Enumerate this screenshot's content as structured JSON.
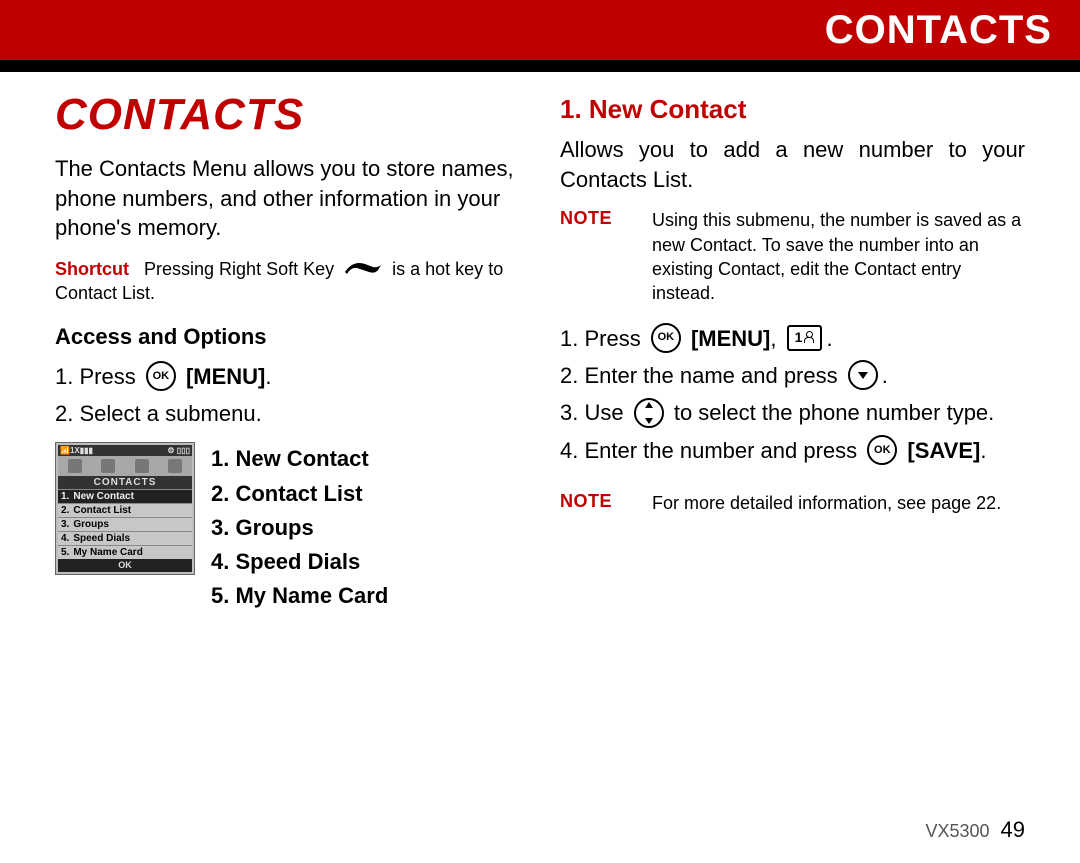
{
  "header": {
    "title": "CONTACTS"
  },
  "left": {
    "chapter": "CONTACTS",
    "intro": "The Contacts Menu allows you to store names, phone numbers, and other information in your phone's memory.",
    "shortcut_label": "Shortcut",
    "shortcut_pre": "Pressing Right Soft Key",
    "shortcut_post": "is a hot key to Contact List.",
    "access_heading": "Access and Options",
    "step1_pre": "1. Press",
    "step1_post": "[MENU]",
    "step2": "2. Select a submenu.",
    "phone": {
      "title": "CONTACTS",
      "items": [
        "New Contact",
        "Contact List",
        "Groups",
        "Speed Dials",
        "My Name Card"
      ],
      "ok": "OK"
    },
    "menu": {
      "i1": "1. New Contact",
      "i2": "2. Contact List",
      "i3": "3. Groups",
      "i4": "4. Speed Dials",
      "i5": "5. My Name Card"
    }
  },
  "right": {
    "heading": "1. New Contact",
    "intro": "Allows you to add a new number to your Contacts List.",
    "note1_label": "NOTE",
    "note1": "Using this submenu, the number is saved as a new Contact. To save the number into an existing Contact, edit the Contact entry instead.",
    "s1_pre": "1. Press",
    "s1_menu": "[MENU]",
    "s1_comma": ",",
    "s1_key": "1",
    "s2_pre": "2. Enter the name and press",
    "s3_pre": "3. Use",
    "s3_post": "to select the phone number type.",
    "s4_pre": "4. Enter the number and press",
    "s4_save": "[SAVE]",
    "note2_label": "NOTE",
    "note2": "For more detailed information, see page 22."
  },
  "footer": {
    "model": "VX5300",
    "page": "49"
  }
}
